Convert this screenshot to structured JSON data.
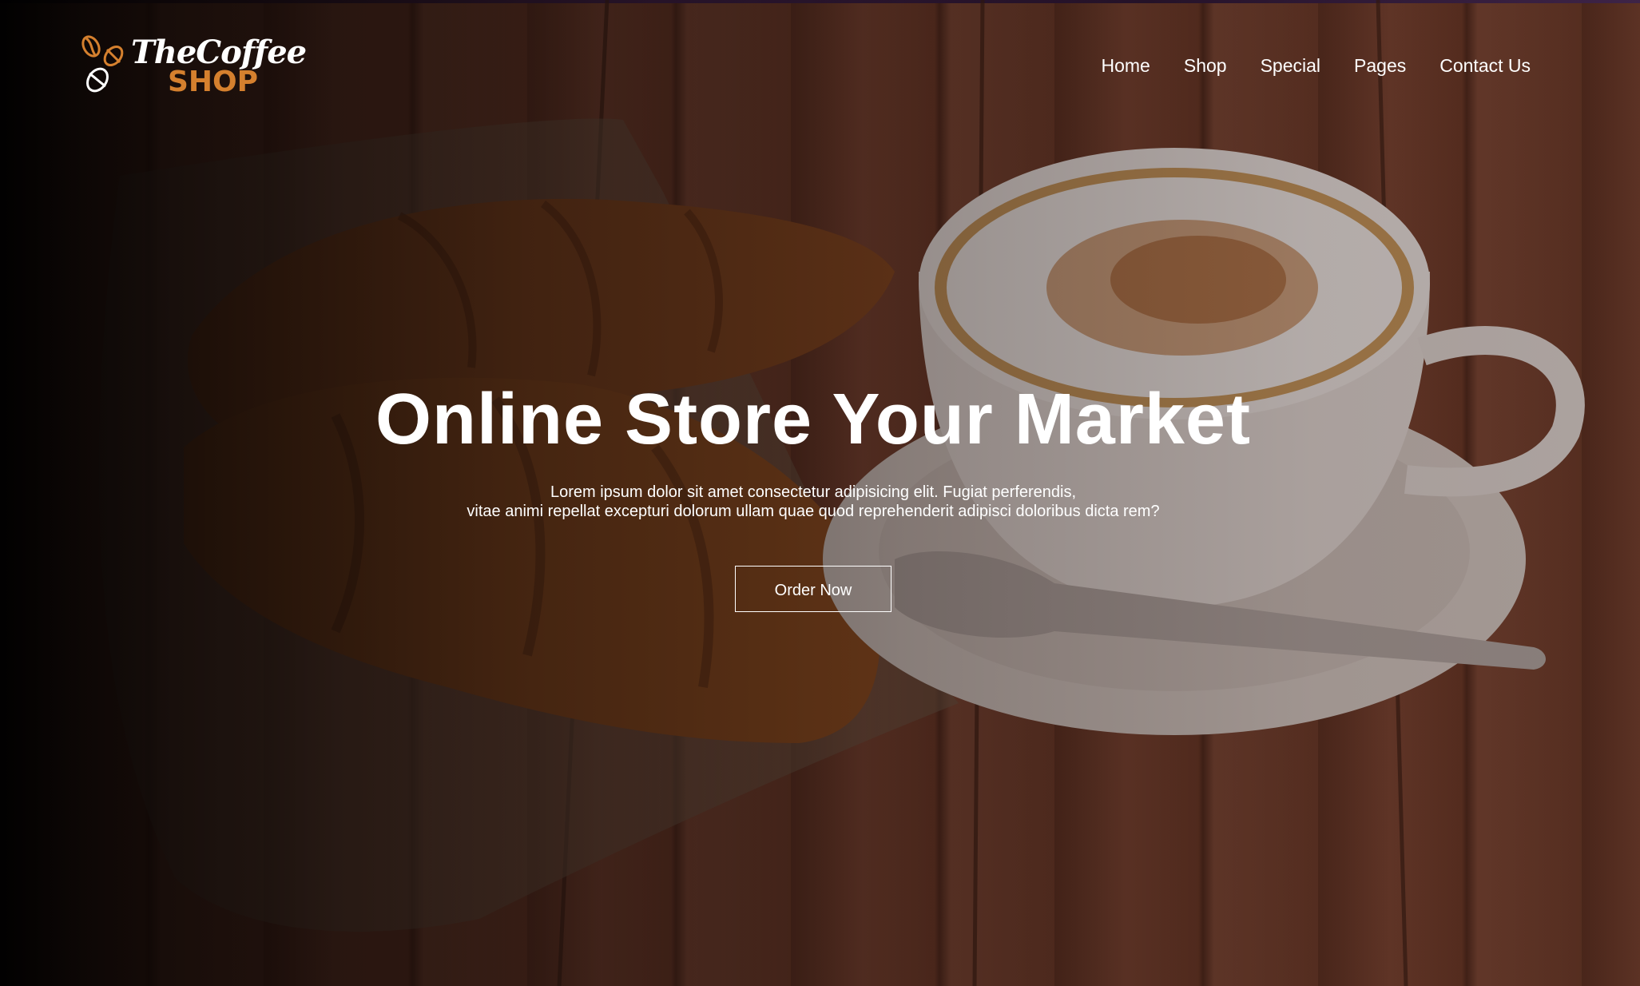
{
  "brand": {
    "name_line1": "TheCoffee",
    "name_line2": "SHOP",
    "accent_color": "#d5802e"
  },
  "nav": {
    "items": [
      {
        "label": "Home"
      },
      {
        "label": "Shop"
      },
      {
        "label": "Special"
      },
      {
        "label": "Pages"
      },
      {
        "label": "Contact Us"
      }
    ]
  },
  "hero": {
    "title": "Online Store Your Market",
    "description_line1": "Lorem ipsum dolor sit amet consectetur adipisicing elit. Fugiat perferendis,",
    "description_line2": "vitae animi repellat excepturi dolorum ullam quae quod reprehenderit adipisci doloribus dicta rem?",
    "cta_label": "Order Now",
    "background_image": "croissant-and-cappuccino-photo"
  }
}
